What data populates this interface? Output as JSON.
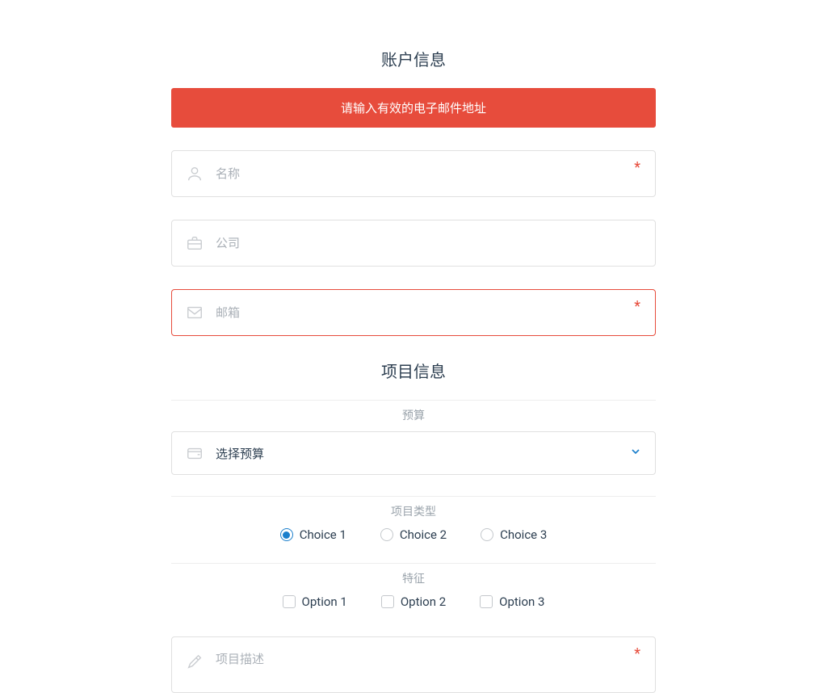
{
  "account": {
    "title": "账户信息",
    "error": "请输入有效的电子邮件地址",
    "name": {
      "placeholder": "名称",
      "required_mark": "*"
    },
    "company": {
      "placeholder": "公司"
    },
    "email": {
      "placeholder": "邮箱",
      "required_mark": "*"
    }
  },
  "project": {
    "title": "项目信息",
    "budget_label": "预算",
    "budget_value": "选择预算",
    "type_label": "项目类型",
    "choices": [
      {
        "label": "Choice 1",
        "checked": true
      },
      {
        "label": "Choice 2",
        "checked": false
      },
      {
        "label": "Choice 3",
        "checked": false
      }
    ],
    "features_label": "特征",
    "options": [
      {
        "label": "Option 1",
        "checked": false
      },
      {
        "label": "Option 2",
        "checked": false
      },
      {
        "label": "Option 3",
        "checked": false
      }
    ],
    "description": {
      "placeholder": "项目描述",
      "required_mark": "*"
    }
  }
}
